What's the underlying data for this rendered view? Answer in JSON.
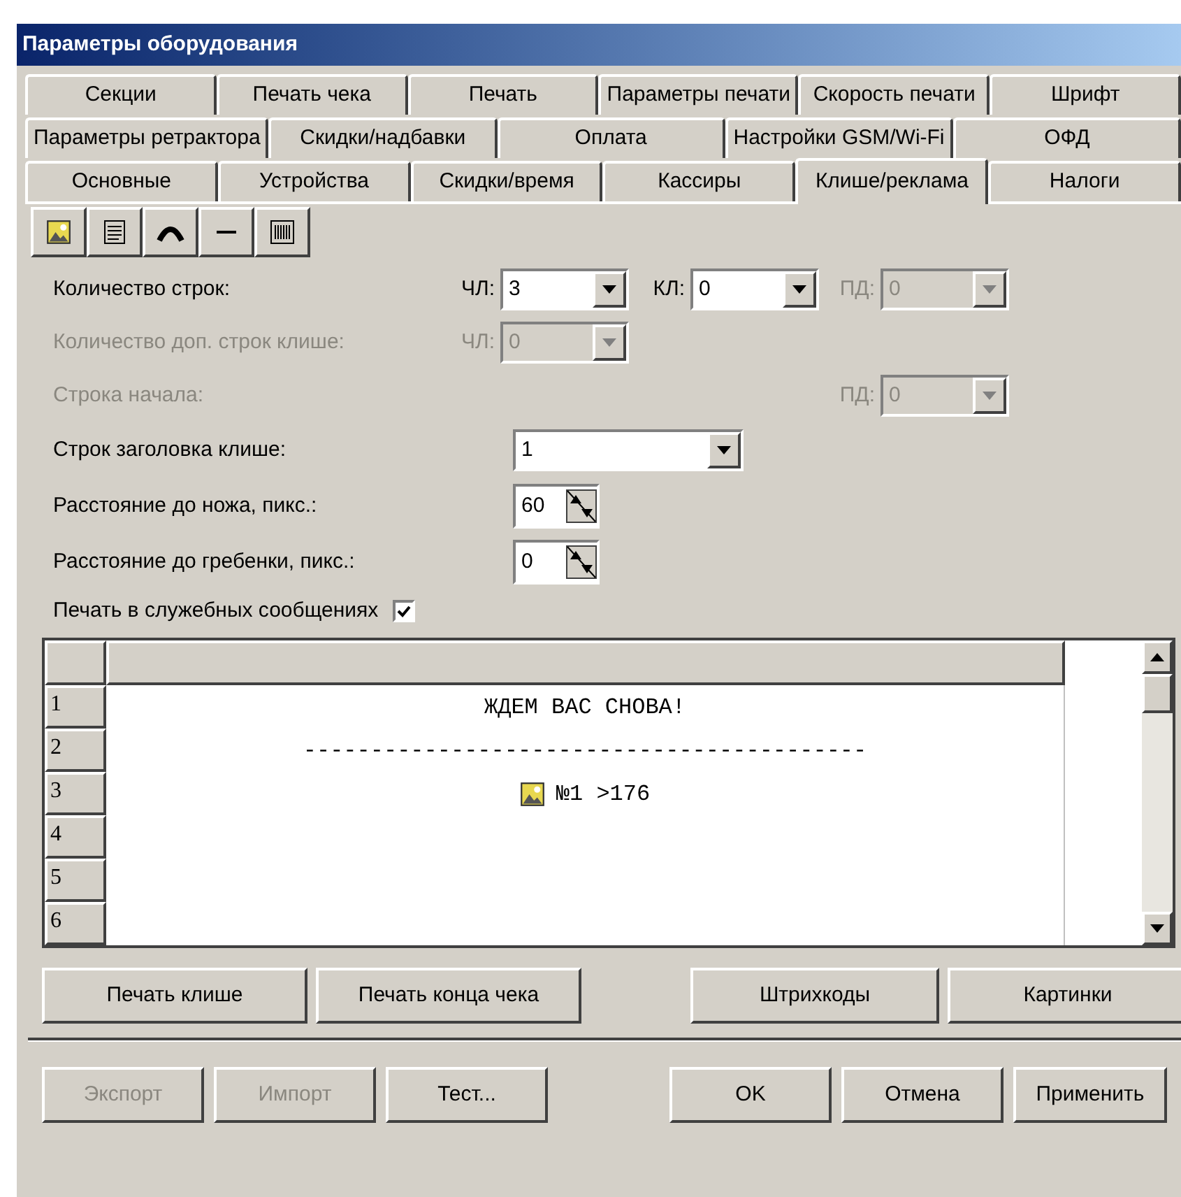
{
  "window": {
    "title": "Параметры оборудования"
  },
  "tab_rows": [
    [
      {
        "label": "Секции",
        "selected": false
      },
      {
        "label": "Печать чека",
        "selected": false
      },
      {
        "label": "Печать",
        "selected": false
      },
      {
        "label": "Параметры печати",
        "selected": false
      },
      {
        "label": "Скорость печати",
        "selected": false
      },
      {
        "label": "Шрифт",
        "selected": false
      }
    ],
    [
      {
        "label": "Параметры ретрактора",
        "selected": false
      },
      {
        "label": "Скидки/надбавки",
        "selected": false
      },
      {
        "label": "Оплата",
        "selected": false
      },
      {
        "label": "Настройки GSM/Wi-Fi",
        "selected": false
      },
      {
        "label": "ОФД",
        "selected": false
      }
    ],
    [
      {
        "label": "Основные",
        "selected": false
      },
      {
        "label": "Устройства",
        "selected": false
      },
      {
        "label": "Скидки/время",
        "selected": false
      },
      {
        "label": "Кассиры",
        "selected": false
      },
      {
        "label": "Клише/реклама",
        "selected": true
      },
      {
        "label": "Налоги",
        "selected": false
      }
    ]
  ],
  "settings": [
    {
      "kind": "selects",
      "label": "Количество строк:",
      "disabled": false,
      "ch": {
        "prefix": "ЧЛ:",
        "value": "3",
        "disabled": false
      },
      "kl": {
        "prefix": "КЛ:",
        "value": "0",
        "disabled": false
      },
      "pd": {
        "prefix": "ПД:",
        "value": "0",
        "disabled": true
      }
    },
    {
      "kind": "selects",
      "label": "Количество доп. строк клише:",
      "disabled": true,
      "ch": {
        "prefix": "ЧЛ:",
        "value": "0",
        "disabled": true
      }
    },
    {
      "kind": "selects",
      "label": "Строка начала:",
      "disabled": true,
      "pd": {
        "prefix": "ПД:",
        "value": "0",
        "disabled": true
      }
    },
    {
      "kind": "dropdown",
      "label": "Строк заголовка клише:",
      "disabled": false,
      "value": "1"
    },
    {
      "kind": "spinner",
      "label": "Расстояние до ножа, пикс.:",
      "disabled": false,
      "value": "60"
    },
    {
      "kind": "spinner",
      "label": "Расстояние до гребенки, пикс.:",
      "disabled": false,
      "value": "0"
    },
    {
      "kind": "checkbox",
      "label": "Печать в служебных сообщениях",
      "disabled": false,
      "checked": true
    }
  ],
  "grid": {
    "rows": [
      {
        "number": "1",
        "kind": "text",
        "text": "ЖДЕМ ВАС СНОВА!"
      },
      {
        "number": "2",
        "kind": "text",
        "text": "------------------------------------------"
      },
      {
        "number": "3",
        "kind": "picture",
        "text": "№1 >176"
      },
      {
        "number": "4",
        "kind": "text"
      },
      {
        "number": "5",
        "kind": "text"
      },
      {
        "number": "6",
        "kind": "text"
      }
    ]
  },
  "action_buttons": [
    {
      "label": "Печать клише",
      "disabled": false
    },
    {
      "label": "Печать конца чека",
      "disabled": false
    },
    {
      "label": "Штрихкоды",
      "disabled": false
    },
    {
      "label": "Картинки",
      "disabled": false
    }
  ],
  "dialog_buttons": [
    {
      "label": "Экспорт",
      "disabled": true
    },
    {
      "label": "Импорт",
      "disabled": true
    },
    {
      "label": "Тест...",
      "disabled": false
    },
    {
      "label": "OK",
      "disabled": false
    },
    {
      "label": "Отмена",
      "disabled": false
    },
    {
      "label": "Применить",
      "disabled": false
    }
  ]
}
